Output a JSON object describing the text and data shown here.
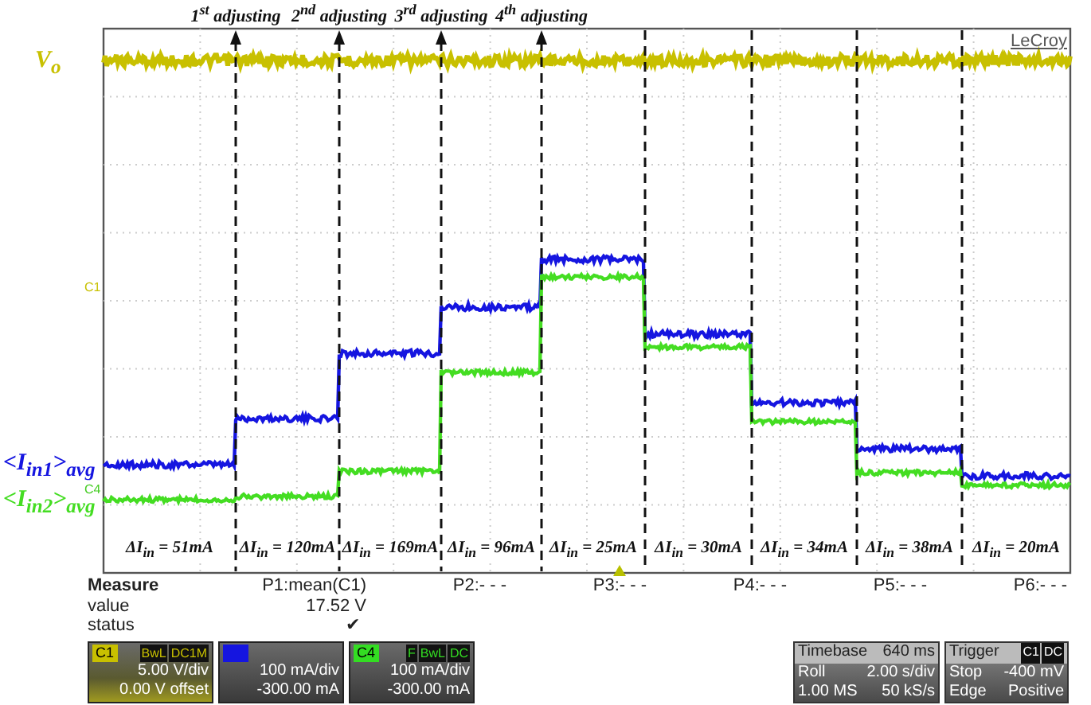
{
  "annotations": {
    "adjustments": [
      {
        "label": "1$^{st}$ adjusting"
      },
      {
        "label": "2$^{nd}$ adjusting"
      },
      {
        "label": "3$^{rd}$ adjusting"
      },
      {
        "label": "4$^{th}$ adjusting"
      }
    ],
    "traces": [
      {
        "label": "V$_{o}$",
        "color": "#c8c000"
      },
      {
        "label": "<I$_{in1}$>$_{avg}$",
        "color": "#1515e0"
      },
      {
        "label": "<I$_{in2}$>$_{avg}$",
        "color": "#44dd22"
      }
    ],
    "deltas": [
      "ΔI$_{in}$ = 51mA",
      "ΔI$_{in}$ = 120mA",
      "ΔI$_{in}$ = 169mA",
      "ΔI$_{in}$ = 96mA",
      "ΔI$_{in}$ = 25mA",
      "ΔI$_{in}$ = 30mA",
      "ΔI$_{in}$ = 34mA",
      "ΔI$_{in}$ = 38mA",
      "ΔI$_{in}$ = 20mA"
    ]
  },
  "screen": {
    "logo": "LeCroy",
    "markers": [
      {
        "label": "C1",
        "color": "#c8c000"
      },
      {
        "label": "C4",
        "color": "#44cc22"
      }
    ]
  },
  "measure": {
    "header": "Measure",
    "row_labels": [
      "value",
      "status"
    ],
    "params": [
      {
        "name": "P1:mean(C1)",
        "value": "17.52 V",
        "status": "✔"
      },
      {
        "name": "P2:- - -"
      },
      {
        "name": "P3:- - -"
      },
      {
        "name": "P4:- - -"
      },
      {
        "name": "P5:- - -"
      },
      {
        "name": "P6:- - -"
      }
    ]
  },
  "channels": [
    {
      "name": "C1",
      "color": "#c8c000",
      "tags": [
        "BwL",
        "DC1M"
      ],
      "scale": "5.00 V/div",
      "offset": "0.00 V offset"
    },
    {
      "color": "#1515e0",
      "scale": "100 mA/div",
      "offset": "-300.00 mA"
    },
    {
      "name": "C4",
      "color": "#33dd22",
      "tags": [
        "F",
        "BwL",
        "DC"
      ],
      "scale": "100 mA/div",
      "offset": "-300.00 mA"
    }
  ],
  "timebase": {
    "title": "Timebase",
    "value": "640 ms",
    "rows": [
      [
        "Roll",
        "2.00 s/div"
      ],
      [
        "1.00 MS",
        "50 kS/s"
      ]
    ]
  },
  "trigger": {
    "title": "Trigger",
    "tags": [
      "C1",
      "DC"
    ],
    "rows": [
      [
        "Stop",
        "-400 mV"
      ],
      [
        "Edge",
        "Positive"
      ]
    ]
  }
}
